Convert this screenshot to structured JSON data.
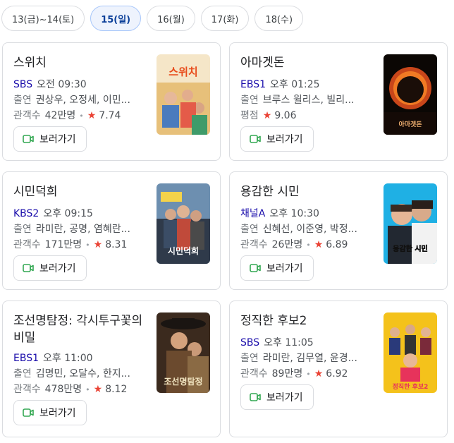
{
  "tabs": [
    {
      "label": "13(금)~14(토)",
      "active": false
    },
    {
      "label": "15(일)",
      "active": true
    },
    {
      "label": "16(월)",
      "active": false
    },
    {
      "label": "17(화)",
      "active": false
    },
    {
      "label": "18(수)",
      "active": false
    }
  ],
  "labels": {
    "cast": "출연",
    "audience": "관객수",
    "rating": "평점",
    "watch": "보러가기"
  },
  "icons": {
    "watch": "video-camera-icon",
    "rating": "star-icon"
  },
  "colors": {
    "channel": "#1a0dab",
    "star": "#ea4335",
    "watch_icon": "#34a853",
    "active_tab": "#0b3f99"
  },
  "movies": [
    {
      "title": "스위치",
      "channel": "SBS",
      "time": "오전 09:30",
      "cast": "권상우, 오정세, 이민...",
      "audience": "42만명",
      "score": "7.74"
    },
    {
      "title": "아마겟돈",
      "channel": "EBS1",
      "time": "오후 01:25",
      "cast": "브루스 윌리스, 빌리...",
      "score": "9.06"
    },
    {
      "title": "시민덕희",
      "channel": "KBS2",
      "time": "오후 09:15",
      "cast": "라미란, 공명, 염혜란...",
      "audience": "171만명",
      "score": "8.31"
    },
    {
      "title": "용감한 시민",
      "channel": "채널A",
      "time": "오후 10:30",
      "cast": "신혜선, 이준영, 박정...",
      "audience": "26만명",
      "score": "6.89"
    },
    {
      "title": "조선명탐정: 각시투구꽃의 비밀",
      "channel": "EBS1",
      "time": "오후 11:00",
      "cast": "김명민, 오달수, 한지...",
      "audience": "478만명",
      "score": "8.12"
    },
    {
      "title": "정직한 후보2",
      "channel": "SBS",
      "time": "오후 11:05",
      "cast": "라미란, 김무열, 윤경...",
      "audience": "89만명",
      "score": "6.92"
    }
  ],
  "posters": [
    {
      "text": "스위치",
      "accent": "#f2a33a"
    },
    {
      "text": "아마겟돈",
      "accent": "#e2531e"
    },
    {
      "text": "시민덕희",
      "accent": "#ffffff"
    },
    {
      "text": "용감한 시민",
      "accent": "#ffffff"
    },
    {
      "text": "조선명탐정",
      "accent": "#f0e4c0"
    },
    {
      "text": "정직한 후보2",
      "accent": "#e7335b"
    }
  ]
}
